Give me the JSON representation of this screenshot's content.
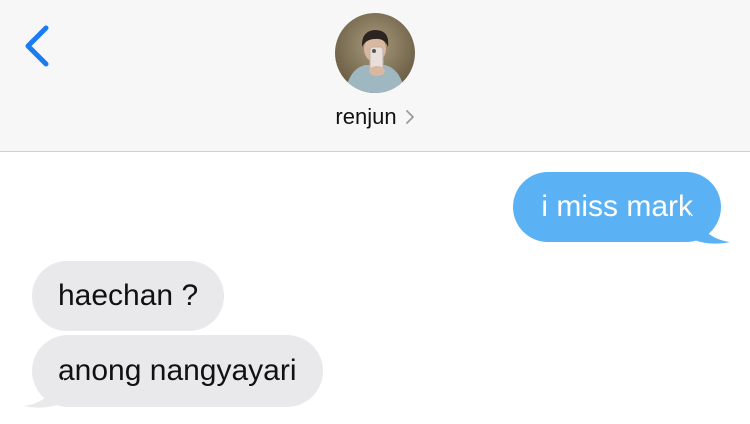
{
  "header": {
    "contact_name": "renjun"
  },
  "icons": {
    "back": "chevron-left-icon",
    "contact_details": "chevron-right-icon"
  },
  "messages": [
    {
      "direction": "sent",
      "text": "i miss mark"
    },
    {
      "direction": "received",
      "text": "haechan ?"
    },
    {
      "direction": "received",
      "text": "anong nangyayari"
    }
  ],
  "colors": {
    "accent": "#1a7cf0",
    "sent_bubble": "#5ab2f5",
    "received_bubble": "#e9e9eb",
    "header_bg": "#f7f7f7"
  }
}
